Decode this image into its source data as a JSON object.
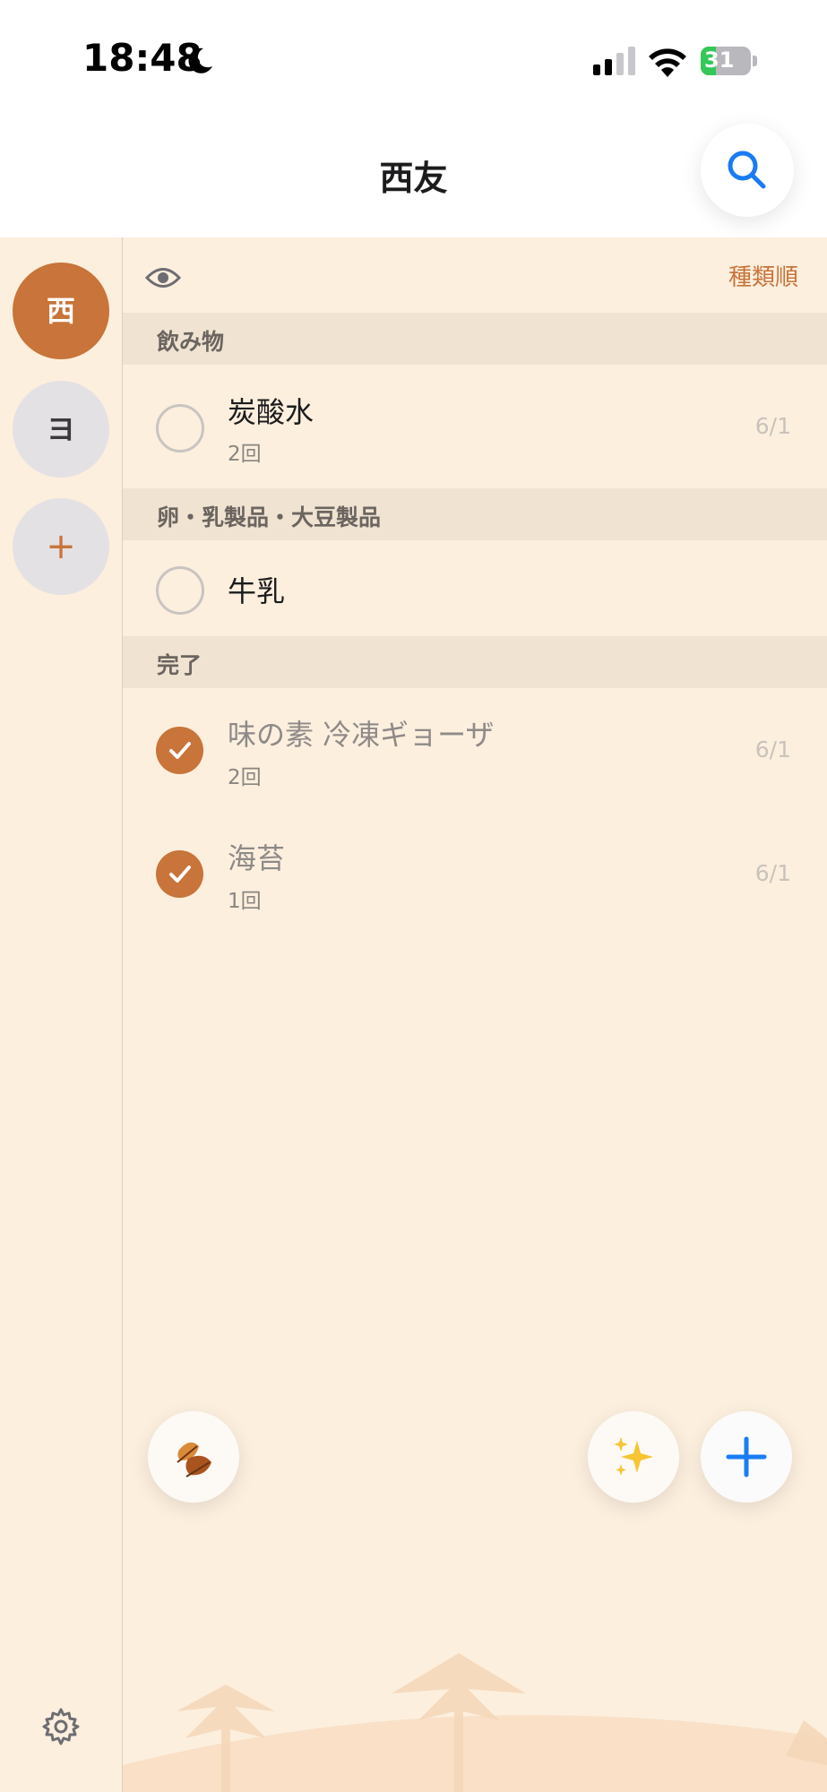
{
  "status_bar": {
    "time": "18:48",
    "battery_percent": "31",
    "battery_level": 0.31,
    "battery_color": "#34c759"
  },
  "header": {
    "title": "西友",
    "search_icon": "search-icon"
  },
  "sidebar": {
    "lists": [
      {
        "label": "西",
        "active": true
      },
      {
        "label": "ヨ",
        "active": false
      }
    ],
    "add_label": "+",
    "settings_icon": "gear-icon"
  },
  "toolbar": {
    "visibility_icon": "eye-icon",
    "sort_label": "種類順"
  },
  "sections": [
    {
      "title": "飲み物",
      "items": [
        {
          "name": "炭酸水",
          "count": "2回",
          "date": "6/1",
          "done": false
        }
      ]
    },
    {
      "title": "卵・乳製品・大豆製品",
      "items": [
        {
          "name": "牛乳",
          "count": "",
          "date": "",
          "done": false
        }
      ]
    },
    {
      "title": "完了",
      "items": [
        {
          "name": "味の素 冷凍ギョーザ",
          "count": "2回",
          "date": "6/1",
          "done": true
        },
        {
          "name": "海苔",
          "count": "1回",
          "date": "6/1",
          "done": true
        }
      ]
    }
  ],
  "bottom_actions": {
    "leaf_icon": "fallen-leaf-icon",
    "sparkle_icon": "sparkles-icon",
    "add_icon": "plus-icon"
  },
  "colors": {
    "accent": "#c8743a",
    "background": "#fcefde",
    "section_bg": "#f0e3d1",
    "ios_blue": "#1a7cf5"
  }
}
